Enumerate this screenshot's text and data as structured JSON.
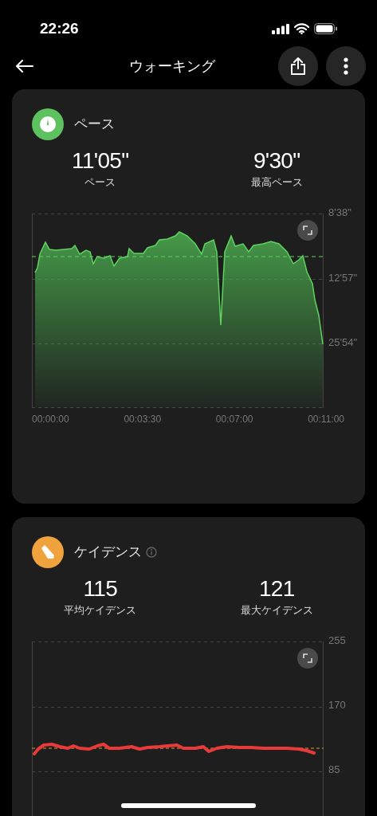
{
  "status_bar": {
    "time": "22:26"
  },
  "header": {
    "title": "ウォーキング"
  },
  "cards": [
    {
      "kind": "pace",
      "title": "ペース",
      "info": false,
      "stats": [
        {
          "value": "11'05\"",
          "label": "ペース"
        },
        {
          "value": "9'30\"",
          "label": "最高ペース"
        }
      ],
      "chart": {
        "y_labels": [
          "8'38\"",
          "12'57\"",
          "25'54\""
        ],
        "x_labels": [
          "00:00:00",
          "00:03:30",
          "00:07:00",
          "00:11:00"
        ]
      }
    },
    {
      "kind": "cadence",
      "title": "ケイデンス",
      "info": true,
      "stats": [
        {
          "value": "115",
          "label": "平均ケイデンス"
        },
        {
          "value": "121",
          "label": "最大ケイデンス"
        }
      ],
      "chart": {
        "y_labels": [
          "255",
          "170",
          "85"
        ]
      }
    }
  ]
}
